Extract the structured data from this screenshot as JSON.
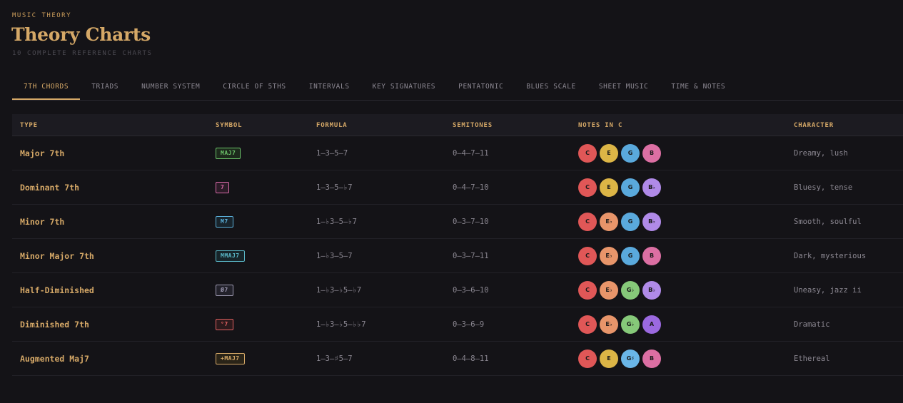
{
  "header": {
    "eyebrow": "MUSIC THEORY",
    "title": "Theory Charts",
    "subtitle": "10 COMPLETE REFERENCE CHARTS"
  },
  "tabs": [
    {
      "label": "7TH CHORDS",
      "active": true
    },
    {
      "label": "TRIADS"
    },
    {
      "label": "NUMBER SYSTEM"
    },
    {
      "label": "CIRCLE OF 5THS"
    },
    {
      "label": "INTERVALS"
    },
    {
      "label": "KEY SIGNATURES"
    },
    {
      "label": "PENTATONIC"
    },
    {
      "label": "BLUES SCALE"
    },
    {
      "label": "SHEET MUSIC"
    },
    {
      "label": "TIME & NOTES"
    }
  ],
  "table": {
    "columns": [
      "TYPE",
      "SYMBOL",
      "FORMULA",
      "SEMITONES",
      "NOTES IN C",
      "CHARACTER"
    ],
    "rows": [
      {
        "type": "Major 7th",
        "symbol": "MAJ7",
        "badge_color": "#6cc46a",
        "badge_bg": "#1d2a1c",
        "formula": "1–3–5–7",
        "semitones": "0–4–7–11",
        "notes": [
          "C",
          "E",
          "G",
          "B"
        ],
        "character": "Dreamy, lush"
      },
      {
        "type": "Dominant 7th",
        "symbol": "7",
        "badge_color": "#d86aa8",
        "badge_bg": "#2a1b26",
        "formula": "1–3–5–♭7",
        "semitones": "0–4–7–10",
        "notes": [
          "C",
          "E",
          "G",
          "B♭"
        ],
        "character": "Bluesy, tense"
      },
      {
        "type": "Minor 7th",
        "symbol": "M7",
        "badge_color": "#5aaed8",
        "badge_bg": "#18242c",
        "formula": "1–♭3–5–♭7",
        "semitones": "0–3–7–10",
        "notes": [
          "C",
          "E♭",
          "G",
          "B♭"
        ],
        "character": "Smooth, soulful"
      },
      {
        "type": "Minor Major 7th",
        "symbol": "MMAJ7",
        "badge_color": "#5ab8c8",
        "badge_bg": "#17252a",
        "formula": "1–♭3–5–7",
        "semitones": "0–3–7–11",
        "notes": [
          "C",
          "E♭",
          "G",
          "B"
        ],
        "character": "Dark, mysterious"
      },
      {
        "type": "Half-Diminished",
        "symbol": "Ø7",
        "badge_color": "#9c98b0",
        "badge_bg": "#22212a",
        "formula": "1–♭3–♭5–♭7",
        "semitones": "0–3–6–10",
        "notes": [
          "C",
          "E♭",
          "G♭",
          "B♭"
        ],
        "character": "Uneasy, jazz ii"
      },
      {
        "type": "Diminished 7th",
        "symbol": "°7",
        "badge_color": "#e06060",
        "badge_bg": "#2c1a1c",
        "formula": "1–♭3–♭5–♭♭7",
        "semitones": "0–3–6–9",
        "notes": [
          "C",
          "E♭",
          "G♭",
          "A"
        ],
        "character": "Dramatic"
      },
      {
        "type": "Augmented Maj7",
        "symbol": "+MAJ7",
        "badge_color": "#d5a867",
        "badge_bg": "#2a2418",
        "formula": "1–3–♯5–7",
        "semitones": "0–4–8–11",
        "notes": [
          "C",
          "E",
          "G♯",
          "B"
        ],
        "character": "Ethereal"
      }
    ]
  },
  "note_colors": {
    "C": "#e05757",
    "E": "#dcb546",
    "E♭": "#e8956a",
    "G": "#5aa9dc",
    "G♭": "#86c979",
    "G♯": "#6ab6e8",
    "B": "#dc6fa3",
    "B♭": "#b08ae8",
    "A": "#9b69e0"
  }
}
